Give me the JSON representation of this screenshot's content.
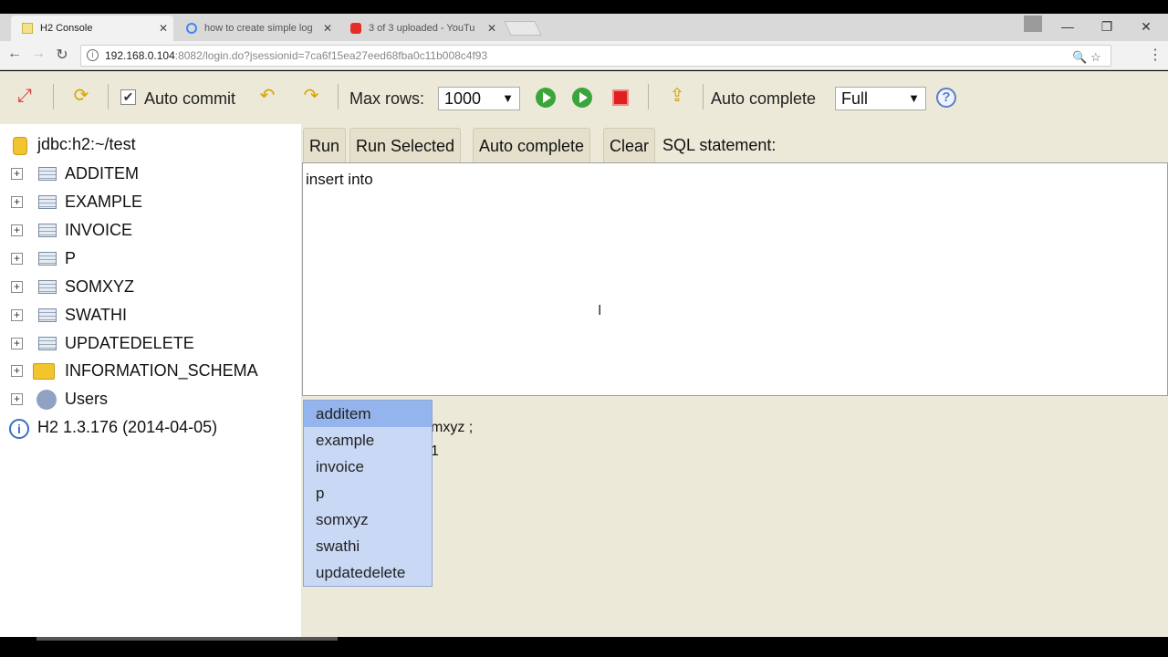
{
  "browser": {
    "tabs": [
      {
        "title": "H2 Console",
        "active": true
      },
      {
        "title": "how to create simple log",
        "active": false
      },
      {
        "title": "3 of 3 uploaded - YouTu",
        "active": false
      }
    ],
    "url_host": "192.168.0.104",
    "url_rest": ":8082/login.do?jsessionid=7ca6f15ea27eed68fba0c11b008c4f93"
  },
  "toolbar": {
    "auto_commit_label": "Auto commit",
    "auto_commit_checked": "✔",
    "max_rows_label": "Max rows:",
    "max_rows_value": "1000",
    "auto_complete_label": "Auto complete",
    "auto_complete_value": "Full",
    "help": "?"
  },
  "tree": {
    "connection": "jdbc:h2:~/test",
    "tables": [
      "ADDITEM",
      "EXAMPLE",
      "INVOICE",
      "P",
      "SOMXYZ",
      "SWATHI",
      "UPDATEDELETE"
    ],
    "schema": "INFORMATION_SCHEMA",
    "users": "Users",
    "version": "H2 1.3.176 (2014-04-05)"
  },
  "editor": {
    "run": "Run",
    "run_selected": "Run Selected",
    "auto_complete": "Auto complete",
    "clear": "Clear",
    "sql_label": "SQL statement:",
    "sql_text": "insert into"
  },
  "result_fragment": {
    "line1": "mxyz ;",
    "line2": "1"
  },
  "autocomplete_items": [
    "additem",
    "example",
    "invoice",
    "p",
    "somxyz",
    "swathi",
    "updatedelete"
  ]
}
